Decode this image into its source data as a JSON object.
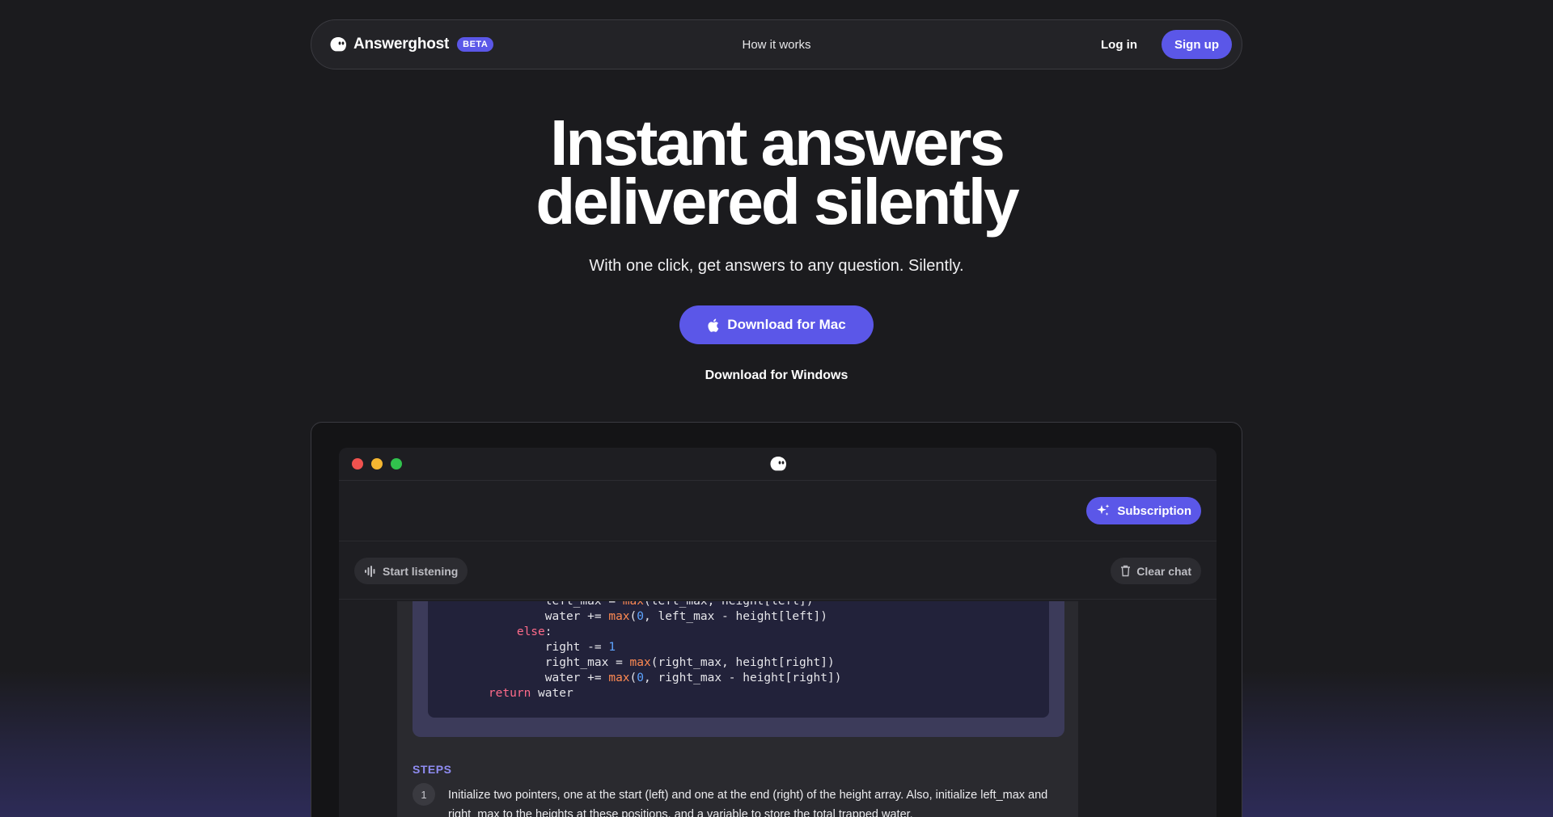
{
  "nav": {
    "brand": "Answerghost",
    "badge": "BETA",
    "center_link": "How it works",
    "login": "Log in",
    "signup": "Sign up"
  },
  "hero": {
    "title_line1": "Instant answers",
    "title_line2": "delivered silently",
    "subtitle": "With one click, get answers to any question. Silently.",
    "download_mac": "Download for Mac",
    "download_windows": "Download for Windows"
  },
  "app": {
    "subscription": "Subscription",
    "start_listening": "Start listening",
    "clear_chat": "Clear chat",
    "code_lines": [
      [
        [
          "            ",
          ""
        ],
        [
          "left_max = ",
          ""
        ],
        [
          "max",
          "fn"
        ],
        [
          "(left_max, height[left])",
          ""
        ]
      ],
      [
        [
          "            ",
          ""
        ],
        [
          "water += ",
          ""
        ],
        [
          "max",
          "fn"
        ],
        [
          "(",
          ""
        ],
        [
          "0",
          "num"
        ],
        [
          ", left_max - height[left])",
          ""
        ]
      ],
      [
        [
          "        ",
          ""
        ],
        [
          "else",
          "kw"
        ],
        [
          ":",
          ""
        ]
      ],
      [
        [
          "            ",
          ""
        ],
        [
          "right -= ",
          ""
        ],
        [
          "1",
          "num"
        ]
      ],
      [
        [
          "            ",
          ""
        ],
        [
          "right_max = ",
          ""
        ],
        [
          "max",
          "fn"
        ],
        [
          "(right_max, height[right])",
          ""
        ]
      ],
      [
        [
          "            ",
          ""
        ],
        [
          "water += ",
          ""
        ],
        [
          "max",
          "fn"
        ],
        [
          "(",
          ""
        ],
        [
          "0",
          "num"
        ],
        [
          ", right_max - height[right])",
          ""
        ]
      ],
      [
        [
          "    ",
          ""
        ],
        [
          "return",
          "kw"
        ],
        [
          " water",
          ""
        ]
      ]
    ],
    "steps_label": "STEPS",
    "steps": [
      {
        "num": "1",
        "text": "Initialize two pointers, one at the start (left) and one at the end (right) of the height array. Also, initialize left_max and right_max to the heights at these positions, and a variable to store the total trapped water."
      }
    ]
  },
  "colors": {
    "accent": "#5b57e8",
    "background": "#1b1b1e",
    "traffic_red": "#f0524f",
    "traffic_yellow": "#f5b731",
    "traffic_green": "#31c24d"
  },
  "icons": [
    "ghost-icon",
    "apple-icon",
    "sparkles-icon",
    "waveform-icon",
    "trash-icon"
  ]
}
